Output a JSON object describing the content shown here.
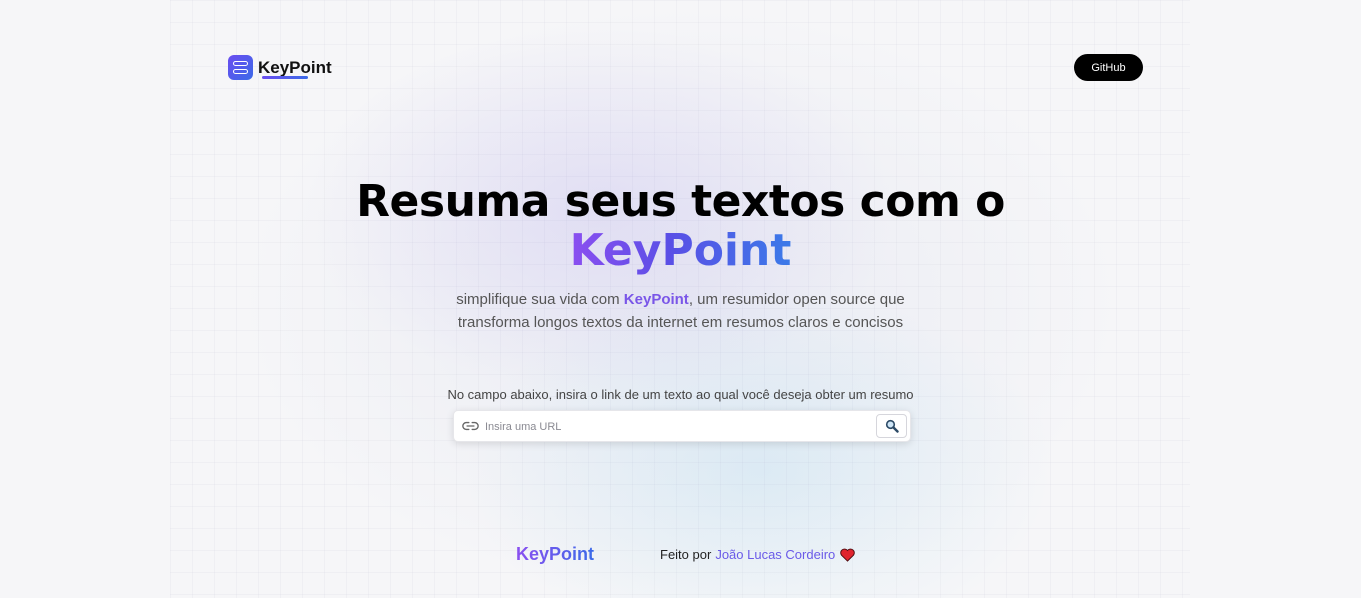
{
  "header": {
    "logo_text": "KeyPoint",
    "github_label": "GitHub"
  },
  "hero": {
    "title_line1": "Resuma seus textos com o",
    "title_brand": "KeyPoint",
    "description_prefix": "simplifique sua vida com ",
    "description_highlight": "KeyPoint",
    "description_suffix": ", um resumidor open source que",
    "description_line2": "transforma longos textos da internet em resumos claros e concisos"
  },
  "search": {
    "prompt": "No campo abaixo, insira o link de um texto ao qual você deseja obter um resumo",
    "placeholder": "Insira uma URL",
    "value": "",
    "link_icon": "link-icon",
    "button_icon": "magnifier-icon"
  },
  "footer": {
    "brand": "KeyPoint",
    "credit_prefix": "Feito por",
    "author": "João Lucas Cordeiro",
    "heart_icon": "heart-icon"
  },
  "colors": {
    "brand_purple": "#8b4ff0",
    "brand_blue": "#3b6ae8",
    "button_black": "#000000"
  }
}
